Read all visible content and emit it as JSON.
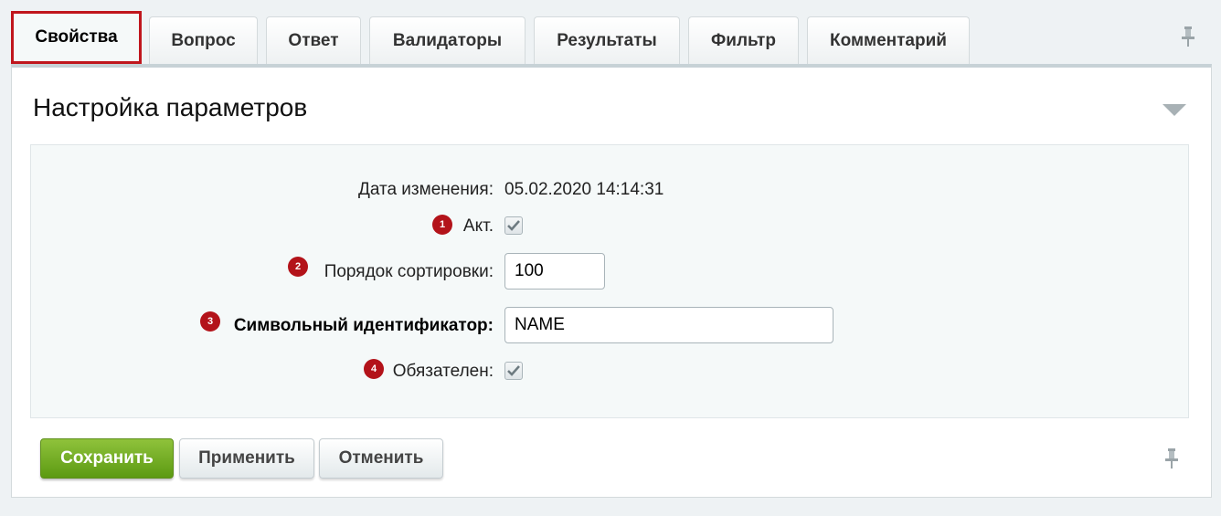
{
  "tabs": [
    {
      "label": "Свойства",
      "active": true
    },
    {
      "label": "Вопрос"
    },
    {
      "label": "Ответ"
    },
    {
      "label": "Валидаторы"
    },
    {
      "label": "Результаты"
    },
    {
      "label": "Фильтр"
    },
    {
      "label": "Комментарий"
    }
  ],
  "panel": {
    "title": "Настройка параметров"
  },
  "form": {
    "date_label": "Дата изменения:",
    "date_value": "05.02.2020 14:14:31",
    "active": {
      "badge": "1",
      "label": "Акт.",
      "checked": true
    },
    "sort": {
      "badge": "2",
      "label": "Порядок сортировки:",
      "value": "100"
    },
    "code": {
      "badge": "3",
      "label": "Символьный идентификатор:",
      "value": "NAME"
    },
    "required": {
      "badge": "4",
      "label": "Обязателен:",
      "checked": true
    }
  },
  "buttons": {
    "save": "Сохранить",
    "apply": "Применить",
    "cancel": "Отменить"
  },
  "colors": {
    "accent_red": "#c0161d",
    "save_green": "#6fa81e"
  },
  "icons": {
    "pin": "pin-icon",
    "collapse": "triangle-down-icon",
    "checkmark": "checkmark-icon"
  }
}
